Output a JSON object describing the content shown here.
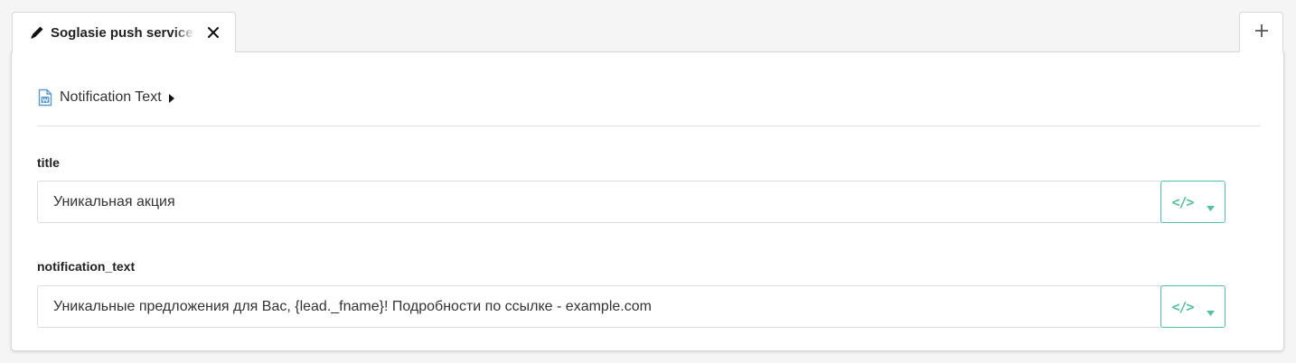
{
  "tabs": [
    {
      "label": "Soglasie push service",
      "icon": "pencil-icon",
      "close_icon": "close-icon"
    }
  ],
  "add_tab": {
    "icon": "plus-icon"
  },
  "breadcrumb": {
    "label": "Notification Text",
    "icon": "word-document-icon",
    "caret": "caret-right-icon"
  },
  "fields": [
    {
      "label": "title",
      "value": "Уникальная акция"
    },
    {
      "label": "notification_text",
      "value": "Уникальные предложения для Вас, {lead._fname}! Подробности по ссылке - example.com"
    }
  ],
  "code_button": {
    "glyph": "</>",
    "icon": "code-icon",
    "dropdown_icon": "caret-down-icon"
  },
  "colors": {
    "accent": "#4fc39a",
    "doc_icon": "#5a9bd5",
    "border": "#dcdcdc"
  }
}
